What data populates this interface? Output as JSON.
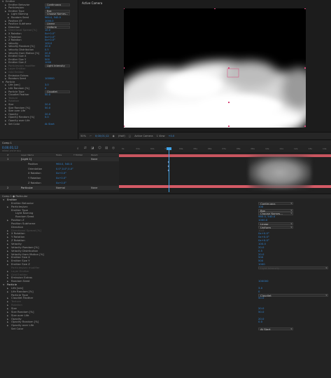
{
  "ec_top": {
    "rows": [
      {
        "label": "Emitter",
        "indent": 0,
        "value": ""
      },
      {
        "label": "Emitter Behavior",
        "indent": 1,
        "value": "Continuous",
        "drop": true
      },
      {
        "label": "Particles/sec",
        "indent": 1,
        "value": "100"
      },
      {
        "label": "Emitter Type",
        "indent": 1,
        "value": "Box",
        "drop": true
      },
      {
        "label": "Light Naming",
        "indent": 2,
        "value": "Choose Names...",
        "drop": true
      },
      {
        "label": "Random Seed",
        "indent": 2,
        "value": "960.0, 540.0"
      },
      {
        "label": "Position XY",
        "indent": 1,
        "value": "1000.0"
      },
      {
        "label": "Position Subframe",
        "indent": 1,
        "value": "Linear",
        "drop": true
      },
      {
        "label": "Direction",
        "indent": 1,
        "value": "Uniform",
        "drop": true
      },
      {
        "label": "Directional Spread [%]",
        "indent": 1,
        "value": "10.0",
        "dim": true
      },
      {
        "label": "X Rotation",
        "indent": 1,
        "value": "0x+0.0°"
      },
      {
        "label": "Y Rotation",
        "indent": 1,
        "value": "0x+0.0°"
      },
      {
        "label": "Z Rotation",
        "indent": 1,
        "value": "0x+0.0°"
      },
      {
        "label": "Velocity",
        "indent": 1,
        "value": "100.0"
      },
      {
        "label": "Velocity Random [%]",
        "indent": 1,
        "value": "20.0"
      },
      {
        "label": "Velocity Distribution",
        "indent": 1,
        "value": "0.5"
      },
      {
        "label": "Velocity from Motion [%]",
        "indent": 1,
        "value": "20.0"
      },
      {
        "label": "Emitter Size X",
        "indent": 1,
        "value": "500"
      },
      {
        "label": "Emitter Size Y",
        "indent": 1,
        "value": "500"
      },
      {
        "label": "Emitter Size Z",
        "indent": 1,
        "value": "1000"
      },
      {
        "label": "Particles/sec modifier",
        "indent": 1,
        "value": "Light Intensity",
        "drop": true,
        "dim": true
      },
      {
        "label": "Layer Emitter",
        "indent": 1,
        "value": "",
        "dim": true
      },
      {
        "label": "Grid Emitter",
        "indent": 1,
        "value": "",
        "dim": true
      },
      {
        "label": "Emission Extras",
        "indent": 1,
        "value": ""
      },
      {
        "label": "Random Seed",
        "indent": 1,
        "value": "100000"
      },
      {
        "label": "Particle",
        "indent": 0,
        "value": ""
      },
      {
        "label": "Life [sec]",
        "indent": 1,
        "value": "3.0"
      },
      {
        "label": "Life Random [%]",
        "indent": 1,
        "value": "0"
      },
      {
        "label": "Particle Type",
        "indent": 1,
        "value": "Cloudlet",
        "drop": true
      },
      {
        "label": "Cloudlet Feather",
        "indent": 1,
        "value": "50.0"
      },
      {
        "label": "Texture",
        "indent": 1,
        "value": "",
        "dim": true
      },
      {
        "label": "Rotation",
        "indent": 1,
        "value": "",
        "dim": true
      },
      {
        "label": "Size",
        "indent": 1,
        "value": "20.0"
      },
      {
        "label": "Size Random [%]",
        "indent": 1,
        "value": "50.0"
      },
      {
        "label": "Size over Life",
        "indent": 1,
        "value": ""
      },
      {
        "label": "Opacity",
        "indent": 1,
        "value": "20.0"
      },
      {
        "label": "Opacity Random [%]",
        "indent": 1,
        "value": "0.0"
      },
      {
        "label": "Opacity over Life",
        "indent": 1,
        "value": ""
      },
      {
        "label": "Set Color",
        "indent": 1,
        "value": "At Start"
      }
    ]
  },
  "viewer": {
    "tab_label": "Active Camera",
    "bar_items": [
      "50%",
      "⌐",
      "0;00;01;12",
      "◉",
      "(Half)",
      "▢",
      "Active Camera",
      "1 View",
      "+0.0"
    ]
  },
  "timeline": {
    "comp_tab": "Comp 1",
    "timecode": "0;00;01;12",
    "fps": "00042 (29.97 fps)",
    "ruler_ticks": [
      "0s",
      "01s",
      "02s",
      "03s",
      "04s",
      "05s",
      "06s",
      "07s",
      "08s",
      "09s",
      "10s",
      "11s",
      "12s",
      "13s",
      "14s"
    ],
    "layers": [
      {
        "num": "1",
        "name": "[Light 1]",
        "mode": "",
        "parent": "None"
      },
      {
        "num": "",
        "name": "Position",
        "mode": "960.0, 540.0",
        "parent": ""
      },
      {
        "num": "",
        "name": "Orientation",
        "mode": "0.0°,0.0°,0.0°",
        "parent": ""
      },
      {
        "num": "",
        "name": "X Rotation",
        "mode": "0x+0.0°",
        "parent": ""
      },
      {
        "num": "",
        "name": "Y Rotation",
        "mode": "0x+0.0°",
        "parent": ""
      },
      {
        "num": "",
        "name": "Z Rotation",
        "mode": "0x+0.0°",
        "parent": ""
      },
      {
        "num": "2",
        "name": "Particular",
        "mode": "Normal",
        "parent": "None"
      }
    ],
    "column_headers": [
      "#",
      "Layer Name",
      "Mode",
      "T TrkMat",
      "Parent"
    ]
  },
  "ec_bottom": {
    "header": "Comp 1 ● Particular",
    "rows": [
      {
        "label": "Emitter",
        "indent": 0,
        "tri": "▼",
        "value": ""
      },
      {
        "label": "Emitter Behavior",
        "indent": 1,
        "value": "Continuous",
        "drop": true
      },
      {
        "label": "Particles/sec",
        "indent": 1,
        "tri": "▶",
        "value": "100"
      },
      {
        "label": "Emitter Type",
        "indent": 1,
        "value": "Box",
        "drop": true
      },
      {
        "label": "Light Naming",
        "indent": 2,
        "value": "Choose Names...",
        "drop": true
      },
      {
        "label": "Random Seed",
        "indent": 2,
        "value": "960.0, 540.0"
      },
      {
        "label": "Position Z",
        "indent": 1,
        "tri": "▶",
        "value": "1000.0"
      },
      {
        "label": "Position Subframe",
        "indent": 1,
        "value": "Linear",
        "drop": true
      },
      {
        "label": "Direction",
        "indent": 1,
        "value": "Uniform",
        "drop": true
      },
      {
        "label": "Directional Spread [%]",
        "indent": 1,
        "tri": "▶",
        "value": "10.0",
        "dim": true
      },
      {
        "label": "X Rotation",
        "indent": 1,
        "tri": "▶",
        "value": "0x+0.0°"
      },
      {
        "label": "Y Rotation",
        "indent": 1,
        "tri": "▶",
        "value": "0x+0.0°"
      },
      {
        "label": "Z Rotation",
        "indent": 1,
        "tri": "▶",
        "value": "0x+0.0°"
      },
      {
        "label": "Velocity",
        "indent": 1,
        "tri": "▶",
        "value": "100.0"
      },
      {
        "label": "Velocity Random [%]",
        "indent": 1,
        "tri": "▶",
        "value": "20.0"
      },
      {
        "label": "Velocity Distribution",
        "indent": 1,
        "tri": "▶",
        "value": "0.5"
      },
      {
        "label": "Velocity from Motion [%]",
        "indent": 1,
        "tri": "▶",
        "value": "20.0"
      },
      {
        "label": "Emitter Size X",
        "indent": 1,
        "tri": "▶",
        "value": "500"
      },
      {
        "label": "Emitter Size Y",
        "indent": 1,
        "tri": "▶",
        "value": "500"
      },
      {
        "label": "Emitter Size Z",
        "indent": 1,
        "tri": "▶",
        "value": "1000"
      },
      {
        "label": "Particles/sec modifier",
        "indent": 1,
        "value": "Light Intensity",
        "drop": true,
        "wide": true,
        "dim": true
      },
      {
        "label": "Layer Emitter",
        "indent": 1,
        "tri": "▶",
        "value": "",
        "dim": true
      },
      {
        "label": "Grid Emitter",
        "indent": 1,
        "tri": "▶",
        "value": "",
        "dim": true
      },
      {
        "label": "Emission Extras",
        "indent": 1,
        "tri": "▶",
        "value": ""
      },
      {
        "label": "Random Seed",
        "indent": 1,
        "tri": "▶",
        "value": "100000"
      },
      {
        "label": "Particle",
        "indent": 0,
        "tri": "▼",
        "value": ""
      },
      {
        "label": "Life [sec]",
        "indent": 1,
        "tri": "▶",
        "value": "3.0"
      },
      {
        "label": "Life Random [%]",
        "indent": 1,
        "tri": "▶",
        "value": "0"
      },
      {
        "label": "Particle Type",
        "indent": 1,
        "value": "Cloudlet",
        "drop": true,
        "wide": true
      },
      {
        "label": "Cloudlet Feather",
        "indent": 1,
        "tri": "▶",
        "value": "50.0"
      },
      {
        "label": "Texture",
        "indent": 1,
        "tri": "▶",
        "value": "",
        "dim": true
      },
      {
        "label": "Rotation",
        "indent": 1,
        "tri": "▶",
        "value": "",
        "dim": true
      },
      {
        "label": "Size",
        "indent": 1,
        "tri": "▶",
        "value": "20.0"
      },
      {
        "label": "Size Random [%]",
        "indent": 1,
        "tri": "▶",
        "value": "50.0"
      },
      {
        "label": "Size over Life",
        "indent": 1,
        "tri": "▶",
        "value": ""
      },
      {
        "label": "Opacity",
        "indent": 1,
        "tri": "▶",
        "value": "20.0"
      },
      {
        "label": "Opacity Random [%]",
        "indent": 1,
        "tri": "▶",
        "value": "0.0"
      },
      {
        "label": "Opacity over Life",
        "indent": 1,
        "tri": "▶",
        "value": ""
      },
      {
        "label": "Set Color",
        "indent": 1,
        "value": "At Start",
        "drop": true
      }
    ]
  },
  "colors": {
    "value_blue": "#2f86d6",
    "playhead": "#3fa3e8",
    "track_red": "#c8555f",
    "handle_pink": "#d8467a"
  }
}
